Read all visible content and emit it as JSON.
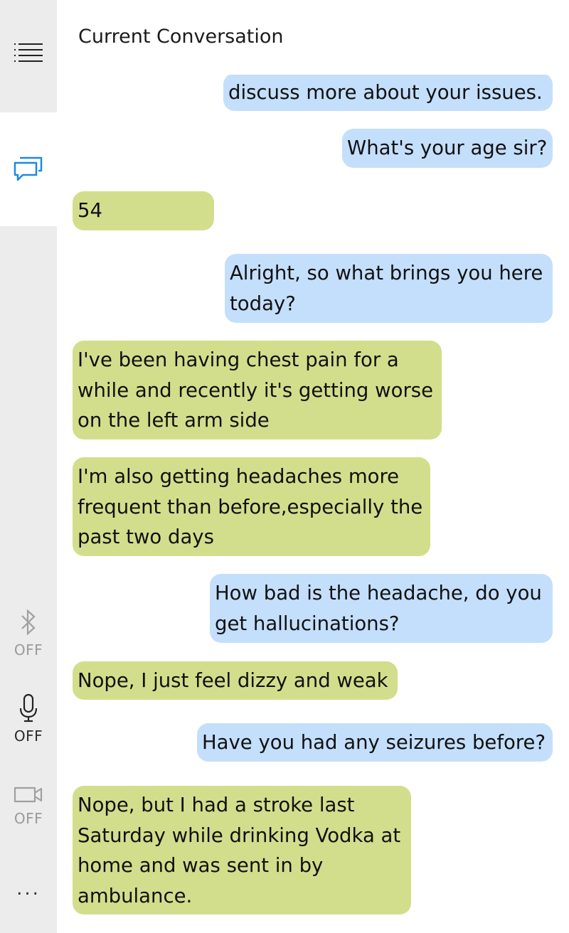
{
  "header": {
    "title": "Current Conversation"
  },
  "sidebar": {
    "menu_icon": "hamburger-list-icon",
    "chat_icon": "chat-bubbles-icon",
    "bluetooth": {
      "icon": "bluetooth-icon",
      "status": "OFF"
    },
    "microphone": {
      "icon": "microphone-icon",
      "status": "OFF"
    },
    "camera": {
      "icon": "video-camera-icon",
      "status": "OFF"
    },
    "more": {
      "icon": "more-dots-icon",
      "label": "..."
    }
  },
  "colors": {
    "sidebar_bg": "#ececec",
    "accent": "#1e88e5",
    "sent_bubble": "#c4dffb",
    "received_bubble": "#d3de8c"
  },
  "messages": [
    {
      "side": "sent",
      "text": "discuss more about your issues."
    },
    {
      "side": "sent",
      "text": "What's your age sir?"
    },
    {
      "side": "received",
      "text": "54"
    },
    {
      "side": "sent",
      "text": "Alright, so what brings you here\ntoday?"
    },
    {
      "side": "received",
      "text": "I've been having chest pain for a\nwhile and recently it's getting worse\non the left arm side"
    },
    {
      "side": "received",
      "text": "I'm also getting headaches more\nfrequent than before,especially the\npast two days"
    },
    {
      "side": "sent",
      "text": "How bad is the headache, do you\nget hallucinations?"
    },
    {
      "side": "received",
      "text": "Nope, I just feel dizzy and weak"
    },
    {
      "side": "sent",
      "text": "Have you had any seizures before?"
    },
    {
      "side": "received",
      "text": "Nope, but I had a stroke last\nSaturday while drinking Vodka at\nhome and was sent in by\nambulance."
    }
  ]
}
